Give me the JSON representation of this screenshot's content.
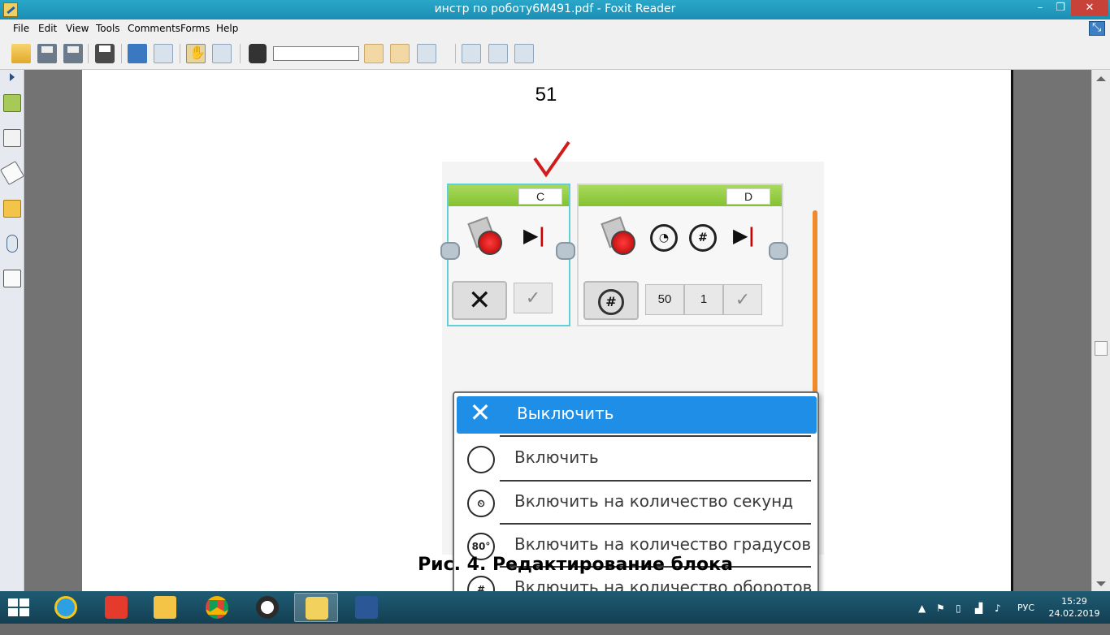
{
  "window": {
    "title": "инстр по роботу6М491.pdf - Foxit Reader",
    "minimize_glyph": "–",
    "maximize_glyph": "❐",
    "close_glyph": "✕"
  },
  "menu": {
    "items": [
      "File",
      "Edit",
      "View",
      "Tools",
      "Comments",
      "Forms",
      "Help"
    ]
  },
  "toolbar": {
    "find_value": "",
    "icons": [
      "open-folder-icon",
      "save-icon",
      "save-as-icon",
      "print-icon",
      "fullscreen-icon",
      "zoom-icon",
      "hand-tool-icon",
      "select-text-icon",
      "find-binoculars-icon",
      "find-previous-icon",
      "find-next-icon",
      "highlight-icon",
      "actual-size-icon",
      "fit-page-icon",
      "fit-width-icon"
    ]
  },
  "sidebar": {
    "icons": [
      "bookmarks-icon",
      "pages-icon",
      "layers-icon",
      "comments-icon",
      "attachments-icon",
      "signatures-icon"
    ]
  },
  "document": {
    "page_number": "51",
    "caption": "Рис. 4. Редактирование блока",
    "figure": {
      "block_left_port": "C",
      "block_right_port": "D",
      "param_power": "50",
      "param_rotations": "1",
      "context_menu": [
        {
          "label": "Выключить",
          "icon": "✕",
          "selected": true
        },
        {
          "label": "Включить",
          "icon": "",
          "selected": false
        },
        {
          "label": "Включить на количество секунд",
          "icon": "⏲",
          "selected": false
        },
        {
          "label": "Включить на количество градусов",
          "icon": "80°",
          "selected": false
        },
        {
          "label": "Включить на количество оборотов",
          "icon": "#",
          "selected": false
        }
      ]
    }
  },
  "taskbar": {
    "apps": [
      "internet-explorer-icon",
      "yandex-browser-icon",
      "file-explorer-icon",
      "chrome-icon",
      "opera-icon",
      "foxit-reader-icon",
      "word-icon"
    ],
    "language": "РУС",
    "time": "15:29",
    "date": "24.02.2019"
  },
  "colors": {
    "titlebar": "#1b8fb3",
    "selection": "#1e8ee6",
    "block_header": "#84c232",
    "taskbar": "#133f52"
  }
}
